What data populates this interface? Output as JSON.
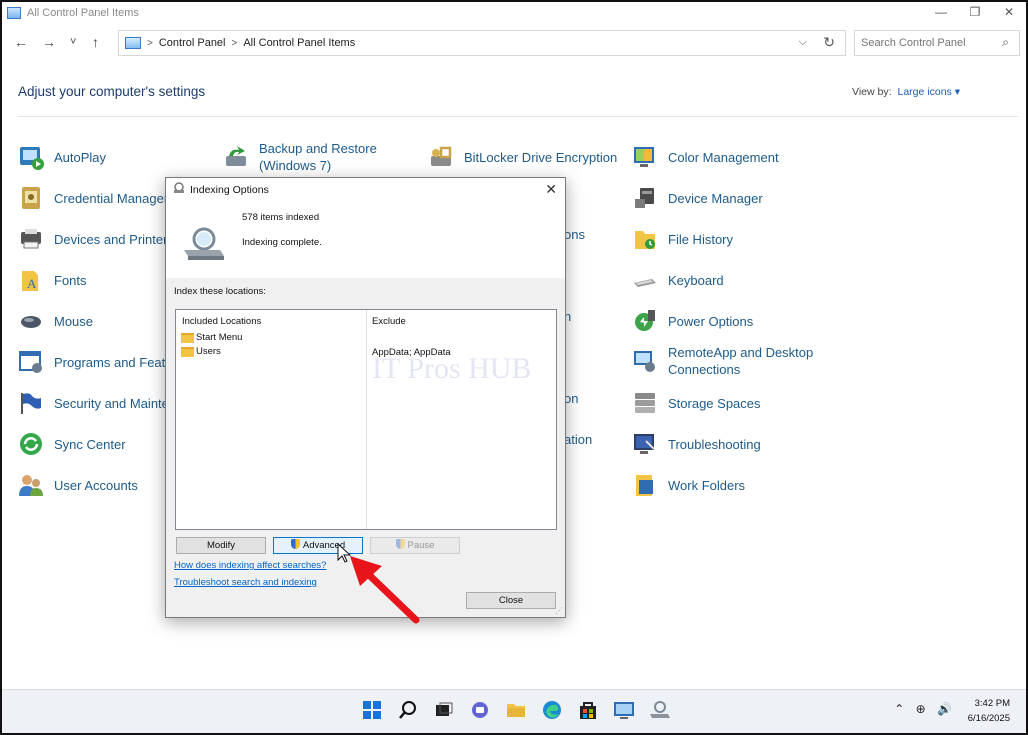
{
  "window": {
    "title": "All Control Panel Items",
    "controls": {
      "minimize": "—",
      "maximize": "❐",
      "close": "✕"
    }
  },
  "nav": {
    "back": "←",
    "forward": "→",
    "recent": "˅",
    "up": "↑",
    "breadcrumb": [
      "Control Panel",
      "All Control Panel Items"
    ],
    "separator": ">",
    "dropdown": "⌵",
    "refresh": "↻"
  },
  "search": {
    "placeholder": "Search Control Panel",
    "icon": "search-icon"
  },
  "header": {
    "title": "Adjust your computer's settings",
    "view_by_label": "View by:",
    "view_by_value": "Large icons ▾"
  },
  "items": [
    {
      "label": "AutoPlay",
      "icon": "autoplay-icon"
    },
    {
      "label": "Backup and Restore (Windows 7)",
      "icon": "backup-restore-icon"
    },
    {
      "label": "BitLocker Drive Encryption",
      "icon": "bitlocker-icon"
    },
    {
      "label": "Color Management",
      "icon": "color-management-icon"
    },
    {
      "label": "Credential Manager",
      "icon": "credential-manager-icon"
    },
    {
      "label": "Device Manager",
      "icon": "device-manager-icon"
    },
    {
      "label": "Devices and Printers",
      "icon": "devices-printers-icon"
    },
    {
      "label": "ons",
      "icon": "partially-hidden-icon"
    },
    {
      "label": "File History",
      "icon": "file-history-icon"
    },
    {
      "label": "Fonts",
      "icon": "fonts-icon"
    },
    {
      "label": "Keyboard",
      "icon": "keyboard-icon"
    },
    {
      "label": "Mouse",
      "icon": "mouse-icon"
    },
    {
      "label": "n",
      "icon": "partially-hidden-icon"
    },
    {
      "label": "Power Options",
      "icon": "power-options-icon"
    },
    {
      "label": "Programs and Features",
      "icon": "programs-features-icon"
    },
    {
      "label": "RemoteApp and Desktop Connections",
      "icon": "remoteapp-icon"
    },
    {
      "label": "Security and Maintenance",
      "icon": "security-maintenance-icon"
    },
    {
      "label": "on",
      "icon": "partially-hidden-icon"
    },
    {
      "label": "Storage Spaces",
      "icon": "storage-spaces-icon"
    },
    {
      "label": "Sync Center",
      "icon": "sync-center-icon"
    },
    {
      "label": "ation",
      "icon": "partially-hidden-icon"
    },
    {
      "label": "Troubleshooting",
      "icon": "troubleshooting-icon"
    },
    {
      "label": "User Accounts",
      "icon": "user-accounts-icon"
    },
    {
      "label": "Work Folders",
      "icon": "work-folders-icon"
    }
  ],
  "dialog": {
    "title": "Indexing Options",
    "close": "✕",
    "items_indexed": "578 items indexed",
    "status": "Indexing complete.",
    "index_label": "Index these locations:",
    "col_included": "Included Locations",
    "col_exclude": "Exclude",
    "locations": [
      {
        "name": "Start Menu",
        "exclude": ""
      },
      {
        "name": "Users",
        "exclude": "AppData; AppData"
      }
    ],
    "watermark": "IT Pros HUB",
    "buttons": {
      "modify": "Modify",
      "advanced": "Advanced",
      "pause": "Pause",
      "close": "Close"
    },
    "links": {
      "affect": "How does indexing affect searches?",
      "troubleshoot": "Troubleshoot search and indexing"
    }
  },
  "taskbar": {
    "icons": [
      "start-icon",
      "search-icon",
      "task-view-icon",
      "chat-icon",
      "file-explorer-icon",
      "edge-icon",
      "store-icon",
      "control-panel-icon",
      "indexing-icon"
    ],
    "tray": "⌃  ⊕  🔊",
    "time": "3:42 PM",
    "date": "6/16/2025"
  },
  "colors": {
    "accent": "#0078d7",
    "link": "#0066cc",
    "heading": "#1e3c6e",
    "annotation": "#e8141b"
  }
}
